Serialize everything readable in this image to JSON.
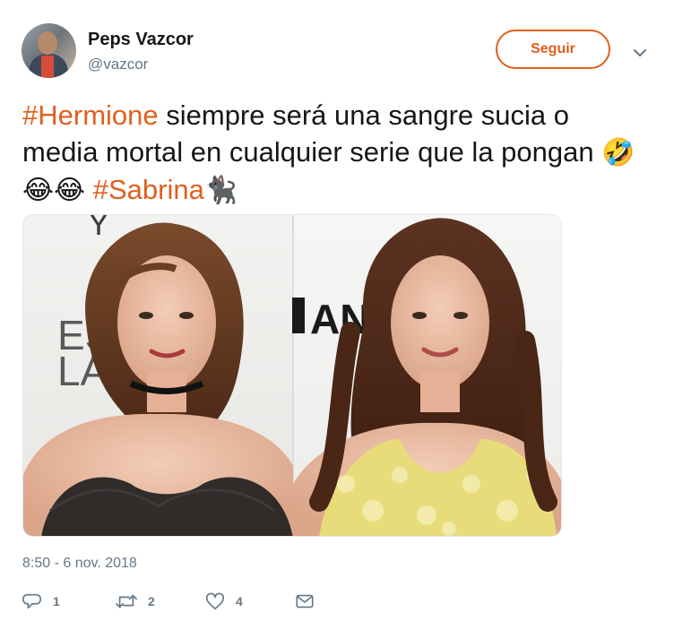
{
  "user": {
    "name": "Peps Vazcor",
    "handle": "@vazcor",
    "follow_label": "Seguir"
  },
  "tweet": {
    "hashtag1": "#Hermione",
    "text_part1": " siempre será una sangre sucia o media mortal en cualquier serie que la pongan ",
    "emojis": "🤣😂😂",
    "hashtag2": "#Sabrina",
    "cat_emoji": "🐈‍⬛",
    "timestamp": "8:50 - 6 nov. 2018"
  },
  "photo": {
    "bg_text_left_1": "Y",
    "bg_text_left_2": "ES",
    "bg_text_left_3": "LA",
    "bg_text_right": "AN"
  },
  "actions": {
    "reply_count": "1",
    "retweet_count": "2",
    "like_count": "4"
  },
  "colors": {
    "accent": "#e0601d",
    "secondary_text": "#657786"
  },
  "icons": [
    "chevron-down-icon",
    "reply-icon",
    "retweet-icon",
    "heart-icon",
    "message-icon"
  ]
}
